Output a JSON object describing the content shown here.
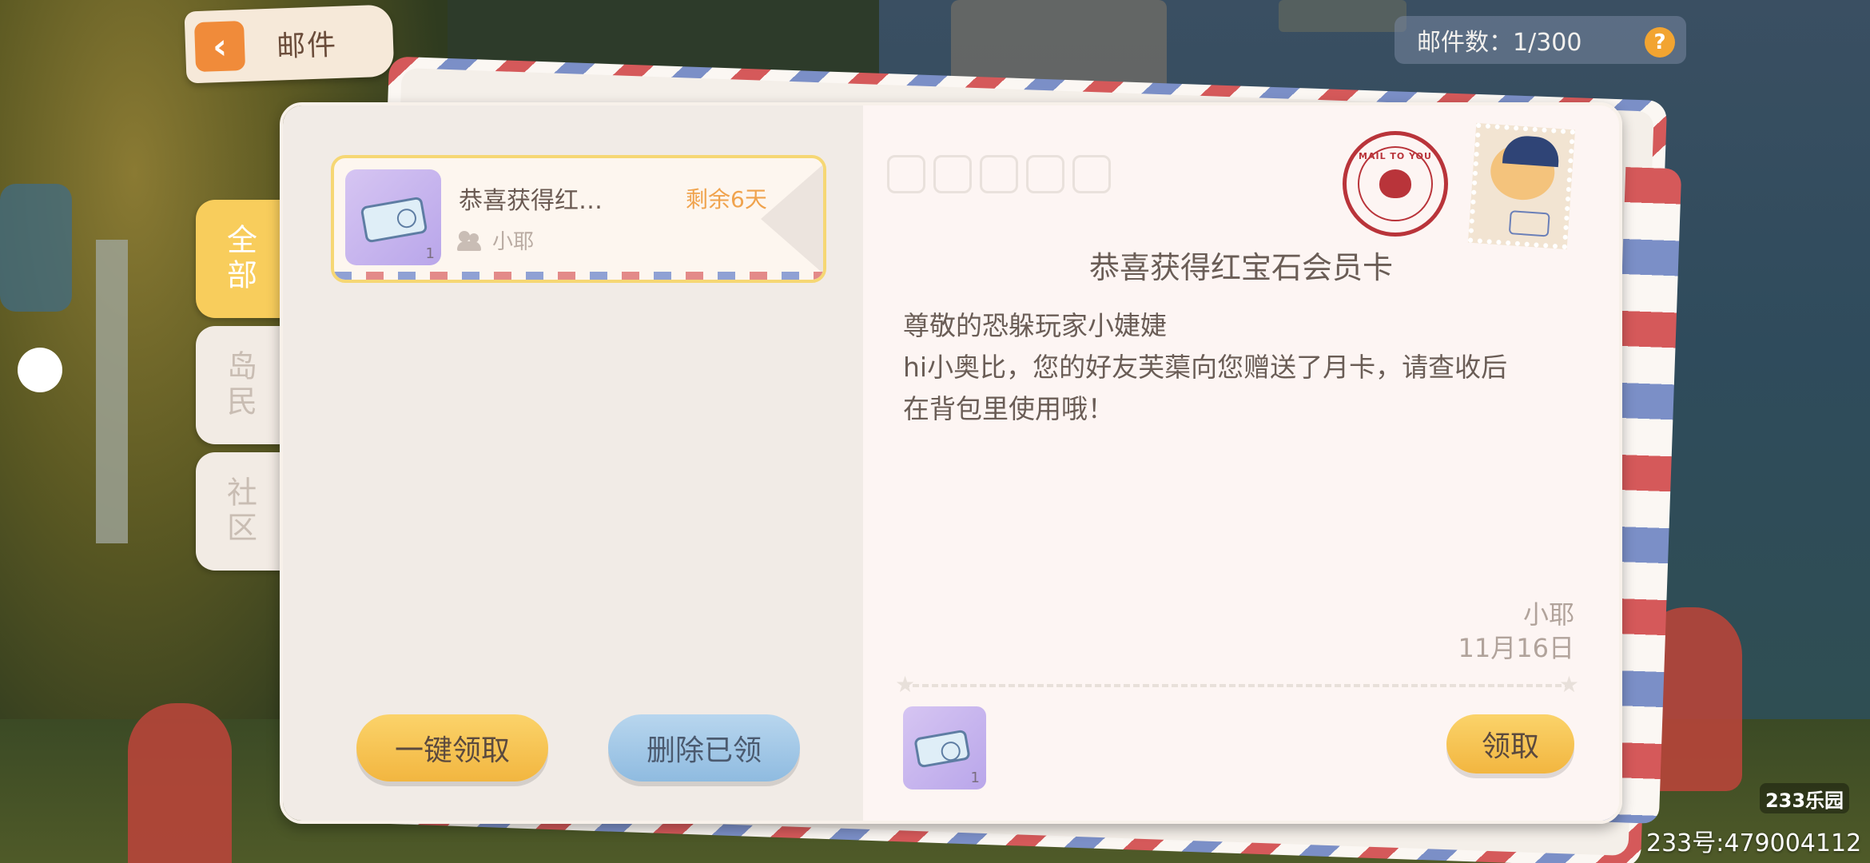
{
  "header": {
    "title": "邮件",
    "mail_count": "邮件数：1/300",
    "help_label": "?"
  },
  "tabs": [
    {
      "label": "全部",
      "active": true
    },
    {
      "label": "岛民",
      "active": false
    },
    {
      "label": "社区",
      "active": false
    }
  ],
  "mail_list": [
    {
      "subject": "恭喜获得红…",
      "sender": "小耶",
      "remaining": "剩余6天",
      "item_qty": "1"
    }
  ],
  "actions": {
    "claim_all": "一键领取",
    "delete_claimed": "删除已领"
  },
  "letter": {
    "title": "恭喜获得红宝石会员卡",
    "greeting": "尊敬的恐躲玩家小婕婕",
    "body_line1": "hi小奥比，您的好友芙蕖向您赠送了月卡，请查收后",
    "body_line2": "在背包里使用哦！",
    "sender": "小耶",
    "date": "11月16日",
    "attachment_qty": "1",
    "claim": "领取",
    "postmark_text": "MAIL TO YOU"
  },
  "watermark": {
    "logo": "233乐园",
    "id": "233号:479004112"
  },
  "colors": {
    "accent_yellow": "#f8cd5c",
    "remaining_orange": "#f0a34d",
    "delete_blue": "#8fbbe0"
  }
}
